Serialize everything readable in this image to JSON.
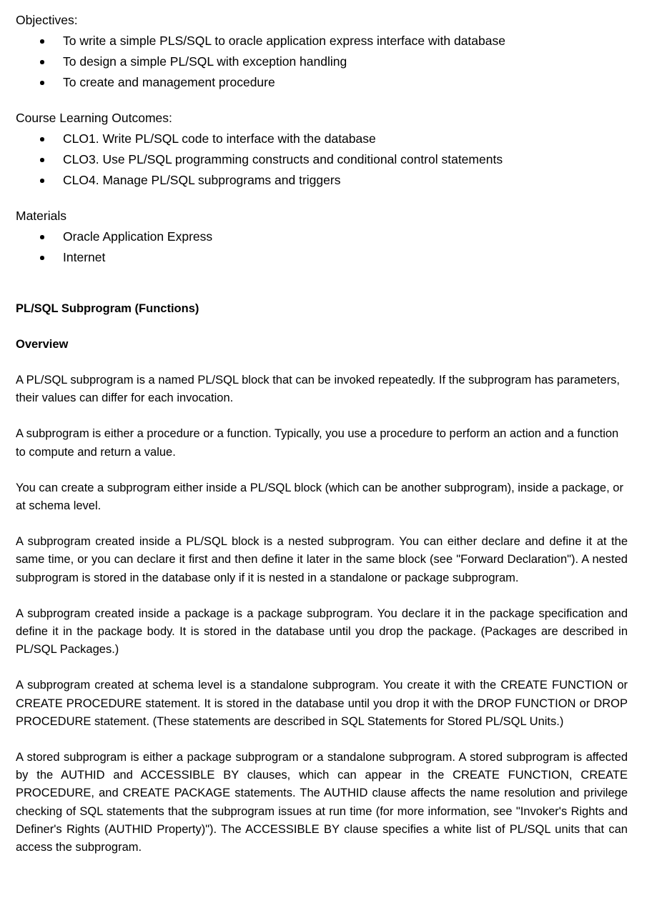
{
  "document": {
    "sections": {
      "objectives": {
        "lead": "Objectives:",
        "items": [
          "To write a simple PLS/SQL to oracle application express interface with database",
          "To design a simple PL/SQL with exception handling",
          "To create and management procedure"
        ]
      },
      "course_learning_outcomes": {
        "lead": "Course Learning Outcomes:",
        "items": [
          "CLO1. Write PL/SQL code to interface with the database",
          "CLO3. Use PL/SQL programming constructs and conditional control statements",
          "CLO4. Manage PL/SQL subprograms and triggers"
        ]
      },
      "materials": {
        "lead": "Materials",
        "items": [
          "Oracle Application Express",
          "Internet"
        ]
      }
    },
    "title": "PL/SQL Subprogram (Functions)",
    "overview_heading": "Overview",
    "paragraphs": [
      "A PL/SQL subprogram is a named PL/SQL block that can be invoked repeatedly. If the subprogram has parameters, their values can differ for each invocation.",
      "A subprogram is either a procedure or a function. Typically, you use a procedure to perform an action and a function to compute and return a value.",
      "You can create a subprogram either inside a PL/SQL block (which can be another subprogram), inside a package, or at schema level.",
      "A subprogram created inside a PL/SQL block is a nested subprogram. You can either declare and define it at the same time, or you can declare it first and then define it later in the same block (see \"Forward Declaration\"). A nested subprogram is stored in the database only if it is nested in a standalone or package subprogram.",
      "A subprogram created inside a package is a package subprogram. You declare it in the package specification and define it in the package body. It is stored in the database until you drop the package. (Packages are described in PL/SQL Packages.)",
      "A subprogram created at schema level is a standalone subprogram. You create it with the CREATE FUNCTION or CREATE PROCEDURE statement. It is stored in the database until you drop it with the DROP FUNCTION or DROP PROCEDURE statement. (These statements are described in SQL Statements for Stored PL/SQL Units.)",
      "A stored subprogram is either a package subprogram or a standalone subprogram. A stored subprogram is affected by the AUTHID and ACCESSIBLE BY clauses, which can appear in the CREATE FUNCTION, CREATE PROCEDURE, and CREATE PACKAGE statements. The AUTHID clause affects the name resolution and privilege checking of SQL statements that the subprogram issues at run time (for more information, see \"Invoker's Rights and Definer's Rights (AUTHID Property)\"). The ACCESSIBLE BY clause specifies a white list of PL/SQL units that can access the subprogram."
    ],
    "colors": {
      "text": "#000000",
      "background": "#ffffff"
    }
  }
}
